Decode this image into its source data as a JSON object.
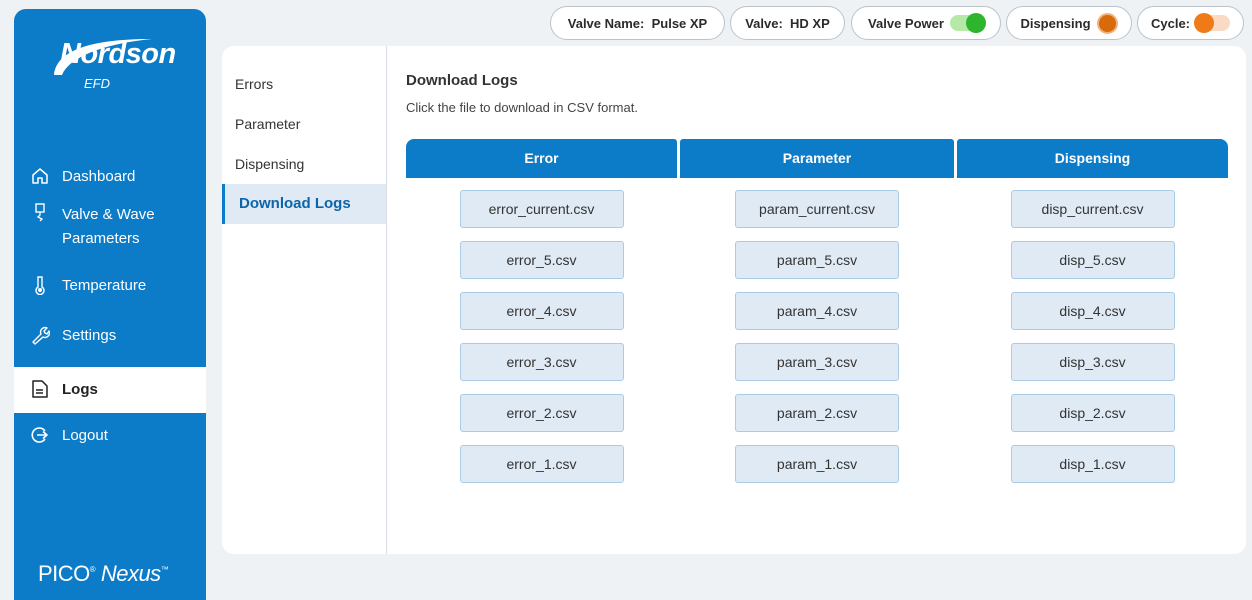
{
  "colors": {
    "primary": "#0c7bc8",
    "active_bg": "#dfeaf5",
    "toggle_green": "#2db52d",
    "indicator_orange": "#d96a0b"
  },
  "brand": {
    "logo_name": "Nordson",
    "logo_sub": "EFD",
    "product": "PICO",
    "product_italic": "Nexus",
    "tm": "™"
  },
  "sidebar": {
    "items": [
      {
        "label": "Dashboard",
        "icon": "home-icon"
      },
      {
        "label": "Valve & Wave Parameters",
        "icon": "valve-icon"
      },
      {
        "label": "Temperature",
        "icon": "thermometer-icon"
      },
      {
        "label": "Settings",
        "icon": "wrench-icon"
      },
      {
        "label": "Logs",
        "icon": "document-icon",
        "active": true
      },
      {
        "label": "Logout",
        "icon": "logout-icon"
      }
    ]
  },
  "status": {
    "valve_name": "Valve Name:  Pulse XP",
    "valve": "Valve:  HD XP",
    "valve_power": "Valve Power",
    "dispensing": "Dispensing",
    "cycle": "Cycle:"
  },
  "subnav": {
    "items": [
      "Errors",
      "Parameter",
      "Dispensing",
      "Download Logs"
    ],
    "active": "Download Logs"
  },
  "content": {
    "title": "Download Logs",
    "subtitle": "Click the file to download in CSV format.",
    "columns": [
      {
        "header": "Error",
        "files": [
          "error_current.csv",
          "error_5.csv",
          "error_4.csv",
          "error_3.csv",
          "error_2.csv",
          "error_1.csv"
        ]
      },
      {
        "header": "Parameter",
        "files": [
          "param_current.csv",
          "param_5.csv",
          "param_4.csv",
          "param_3.csv",
          "param_2.csv",
          "param_1.csv"
        ]
      },
      {
        "header": "Dispensing",
        "files": [
          "disp_current.csv",
          "disp_5.csv",
          "disp_4.csv",
          "disp_3.csv",
          "disp_2.csv",
          "disp_1.csv"
        ]
      }
    ]
  }
}
